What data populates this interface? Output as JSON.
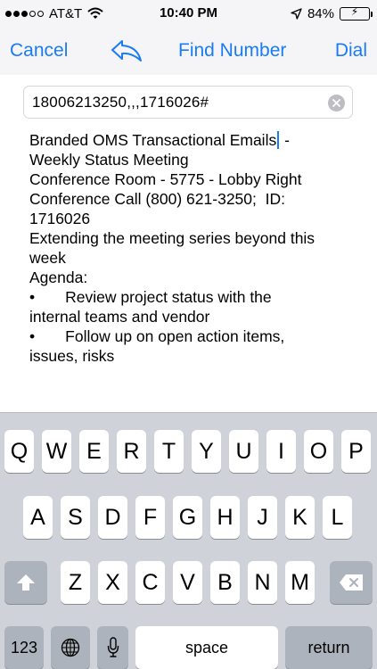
{
  "status_bar": {
    "carrier": "AT&T",
    "time": "10:40 PM",
    "battery": "84%",
    "battery_level": 0.84
  },
  "nav": {
    "cancel": "Cancel",
    "find_number": "Find Number",
    "dial": "Dial"
  },
  "search": {
    "value": "18006213250,,,1716026#"
  },
  "content": {
    "l1a": "Branded OMS Transactional Emails",
    "l1b": " -",
    "l2": "Weekly Status Meeting",
    "l3": "Conference Room - 5775 - Lobby Right",
    "l4": "Conference Call (800) 621-3250;  ID:",
    "l5": "1716026",
    "l6": "Extending the meeting series beyond this",
    "l7": "week",
    "l8": "Agenda:",
    "l9": "•       Review project status with the",
    "l10": "internal teams and vendor",
    "l11": "•       Follow up on open action items,",
    "l12": "issues, risks"
  },
  "keyboard": {
    "row1": [
      "Q",
      "W",
      "E",
      "R",
      "T",
      "Y",
      "U",
      "I",
      "O",
      "P"
    ],
    "row2": [
      "A",
      "S",
      "D",
      "F",
      "G",
      "H",
      "J",
      "K",
      "L"
    ],
    "row3": [
      "Z",
      "X",
      "C",
      "V",
      "B",
      "N",
      "M"
    ],
    "numbers": "123",
    "space": "space",
    "return": "return"
  }
}
